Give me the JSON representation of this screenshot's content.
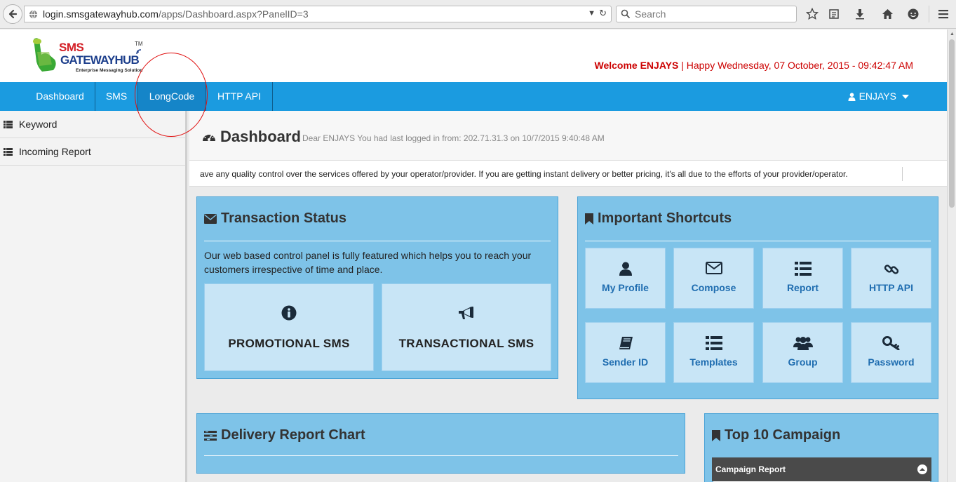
{
  "browser": {
    "url_host": "login.smsgatewayhub.com",
    "url_path": "/apps/Dashboard.aspx?PanelID=3",
    "search_placeholder": "Search"
  },
  "header": {
    "logo_sms": "SMS",
    "logo_gateway": "GATEWAYHUB",
    "logo_tm": "TM",
    "logo_tagline": "Enterprise Messaging Solution",
    "welcome_strong": "Welcome ENJAYS",
    "welcome_sep": " | ",
    "welcome_date": "Happy Wednesday, 07 October, 2015 - 09:42:47 AM"
  },
  "nav": {
    "items": [
      {
        "label": "Dashboard"
      },
      {
        "label": "SMS"
      },
      {
        "label": "LongCode"
      },
      {
        "label": "HTTP API"
      }
    ],
    "user_label": "ENJAYS"
  },
  "sidebar": {
    "items": [
      {
        "label": "Keyword"
      },
      {
        "label": "Incoming Report"
      }
    ]
  },
  "dashboard": {
    "title": "Dashboard",
    "subtitle": "Dear ENJAYS You had last logged in from: 202.71.31.3 on 10/7/2015 9:40:48 AM",
    "marquee": "ave any quality control over the services offered by your operator/provider. If you are getting instant delivery or better pricing, it's all due to the efforts of your provider/operator."
  },
  "transaction": {
    "title": "Transaction Status",
    "description": "Our web based control panel is fully featured which helps you to reach your customers irrespective of time and place.",
    "promo_label": "PROMOTIONAL SMS",
    "trans_label": "TRANSACTIONAL SMS"
  },
  "shortcuts": {
    "title": "Important Shortcuts",
    "items": [
      {
        "label": "My Profile"
      },
      {
        "label": "Compose"
      },
      {
        "label": "Report"
      },
      {
        "label": "HTTP API"
      },
      {
        "label": "Sender ID"
      },
      {
        "label": "Templates"
      },
      {
        "label": "Group"
      },
      {
        "label": "Password"
      }
    ]
  },
  "delivery": {
    "title": "Delivery Report Chart"
  },
  "campaign": {
    "title": "Top 10 Campaign",
    "bar_label": "Campaign Report"
  },
  "colors": {
    "nav_blue": "#1b9be0",
    "panel_blue": "#7ec3e8",
    "card_blue": "#c8e5f6",
    "welcome_red": "#cc0000",
    "link_blue": "#1f6db0"
  }
}
